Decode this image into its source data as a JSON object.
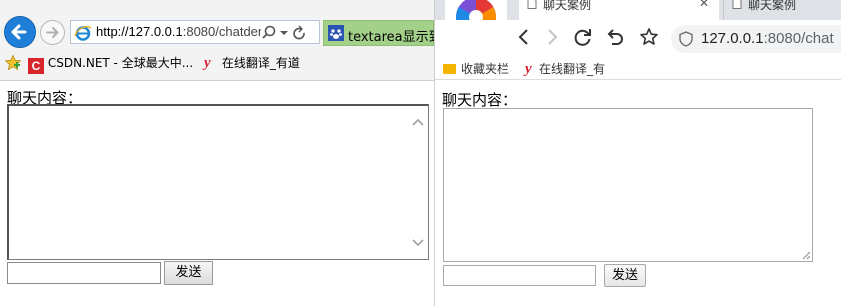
{
  "ie_window": {
    "address_url_host": "http://127.0.0.1",
    "address_url_rest": ":8080/chatden",
    "tab_title": "textarea显示到",
    "favorites": [
      {
        "label": "CSDN.NET - 全球最大中..."
      },
      {
        "label": "在线翻译_有道"
      }
    ],
    "page": {
      "label": "聊天内容：",
      "textarea_value": "",
      "input_value": "",
      "send_button": "发送"
    }
  },
  "chrome_window": {
    "tabs": [
      {
        "title": "聊天案例",
        "active": true
      },
      {
        "title": "聊天案例",
        "active": false
      }
    ],
    "address_host": "127.0.0.1",
    "address_rest": ":8080/chat",
    "bookmarks": [
      {
        "label": "收藏夹栏",
        "icon": "folder-icon"
      },
      {
        "label": "在线翻译_有",
        "icon": "youdao-icon"
      }
    ],
    "page": {
      "label": "聊天内容：",
      "textarea_value": "",
      "input_value": "",
      "send_button": "发送"
    }
  },
  "colors": {
    "ie_back_button": "#1f7fd8",
    "ie_tab_active": "#a3d18a",
    "csdn_red": "#d9262a",
    "youdao_red": "#d62030",
    "chrome_tabstrip": "#dee1e6"
  }
}
